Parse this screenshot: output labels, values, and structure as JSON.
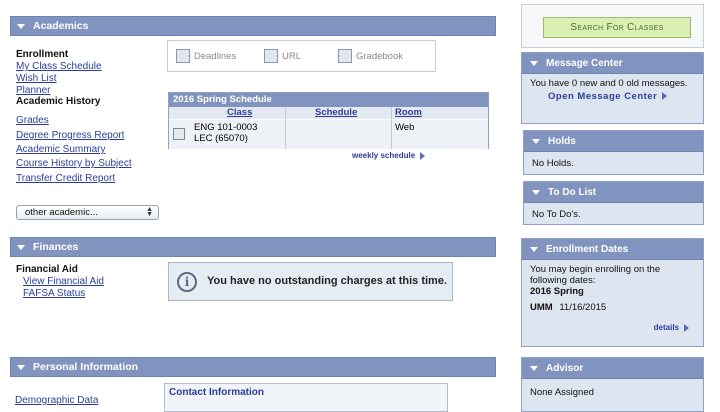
{
  "academics": {
    "header": "Academics",
    "enrollment_label": "Enrollment",
    "enrollment_links": [
      "My Class Schedule",
      "Wish List",
      "Planner"
    ],
    "history_label": "Academic History",
    "history_links": [
      "Grades",
      "Degree Progress Report",
      "Academic Summary",
      "Course History by Subject",
      "Transfer Credit Report"
    ],
    "other_select": "other academic...",
    "quick_links": [
      "Deadlines",
      "URL",
      "Gradebook"
    ],
    "schedule": {
      "title": "2016 Spring Schedule",
      "col_class": "Class",
      "col_schedule": "Schedule",
      "col_room": "Room",
      "row_class_line1": "ENG 101-0003",
      "row_class_line2": "LEC (65070)",
      "row_schedule": "",
      "row_room": "Web",
      "weekly_link": "weekly schedule"
    }
  },
  "finances": {
    "header": "Finances",
    "aid_label": "Financial Aid",
    "links": [
      "View Financial Aid",
      "FAFSA Status"
    ],
    "message": "You have no outstanding charges at this time."
  },
  "personal": {
    "header": "Personal Information",
    "demographic_link": "Demographic Data",
    "contact_title": "Contact Information"
  },
  "sidebar": {
    "search_button": "Search For Classes",
    "message_center": {
      "title": "Message Center",
      "text": "You have 0 new and 0 old messages.",
      "link": "Open Message Center"
    },
    "holds": {
      "title": "Holds",
      "text": "No Holds."
    },
    "todo": {
      "title": "To Do List",
      "text": "No To Do's."
    },
    "enrollment_dates": {
      "title": "Enrollment Dates",
      "text": "You may begin enrolling on the following dates:",
      "term": "2016 Spring",
      "campus": "UMM",
      "date": "11/16/2015",
      "details_link": "details"
    },
    "advisor": {
      "title": "Advisor",
      "text": "None Assigned"
    }
  }
}
